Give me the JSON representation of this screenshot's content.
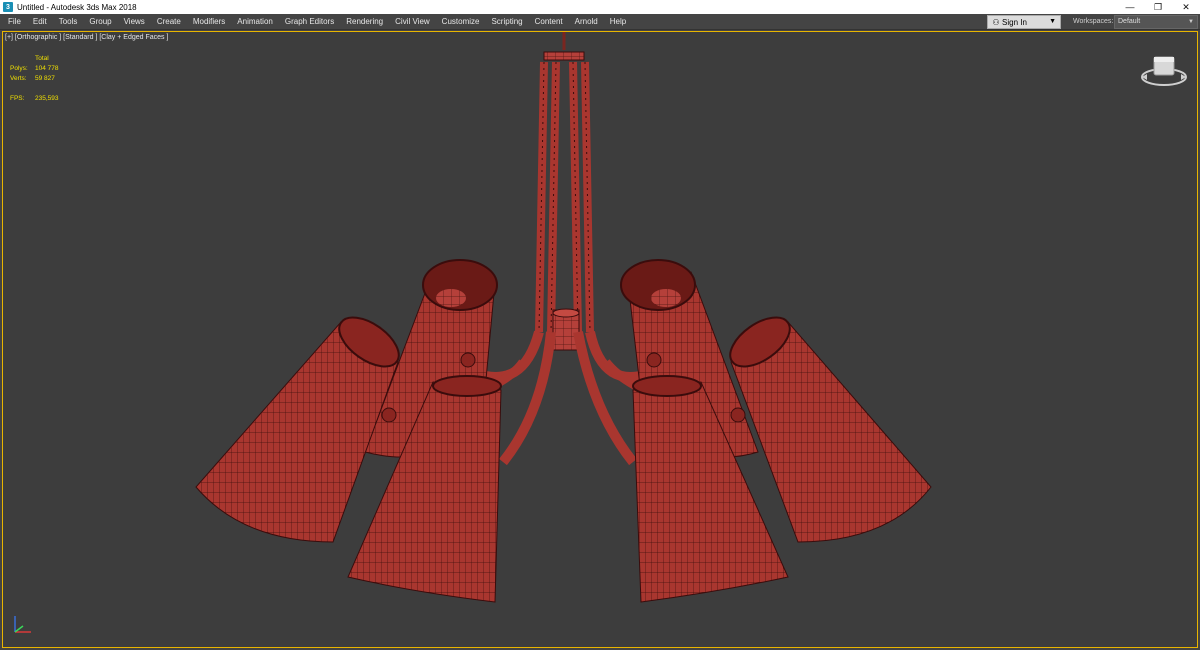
{
  "window": {
    "title": "Untitled - Autodesk 3ds Max 2018",
    "app_icon": "3",
    "controls": {
      "minimize": "—",
      "restore": "❐",
      "close": "✕"
    }
  },
  "menu": {
    "items": [
      "File",
      "Edit",
      "Tools",
      "Group",
      "Views",
      "Create",
      "Modifiers",
      "Animation",
      "Graph Editors",
      "Rendering",
      "Civil View",
      "Customize",
      "Scripting",
      "Content",
      "Arnold",
      "Help"
    ]
  },
  "account": {
    "signin_label": "Sign In",
    "caret": "▼"
  },
  "workspaces": {
    "label": "Workspaces:",
    "value": "Default",
    "caret": "▼"
  },
  "viewport": {
    "label": "[+] [Orthographic ] [Standard ] [Clay + Edged Faces ]",
    "stats": {
      "header": "Total",
      "polys_label": "Polys:",
      "polys_value": "104 778",
      "verts_label": "Verts:",
      "verts_value": "59 827",
      "fps_label": "FPS:",
      "fps_value": "235,593"
    },
    "border_color": "#e8b500",
    "model_color": "#b03a33",
    "wire_color": "#3a0c0c"
  },
  "icons": [
    "app-icon",
    "user-icon",
    "viewcube-icon",
    "axis-tripod-icon"
  ]
}
